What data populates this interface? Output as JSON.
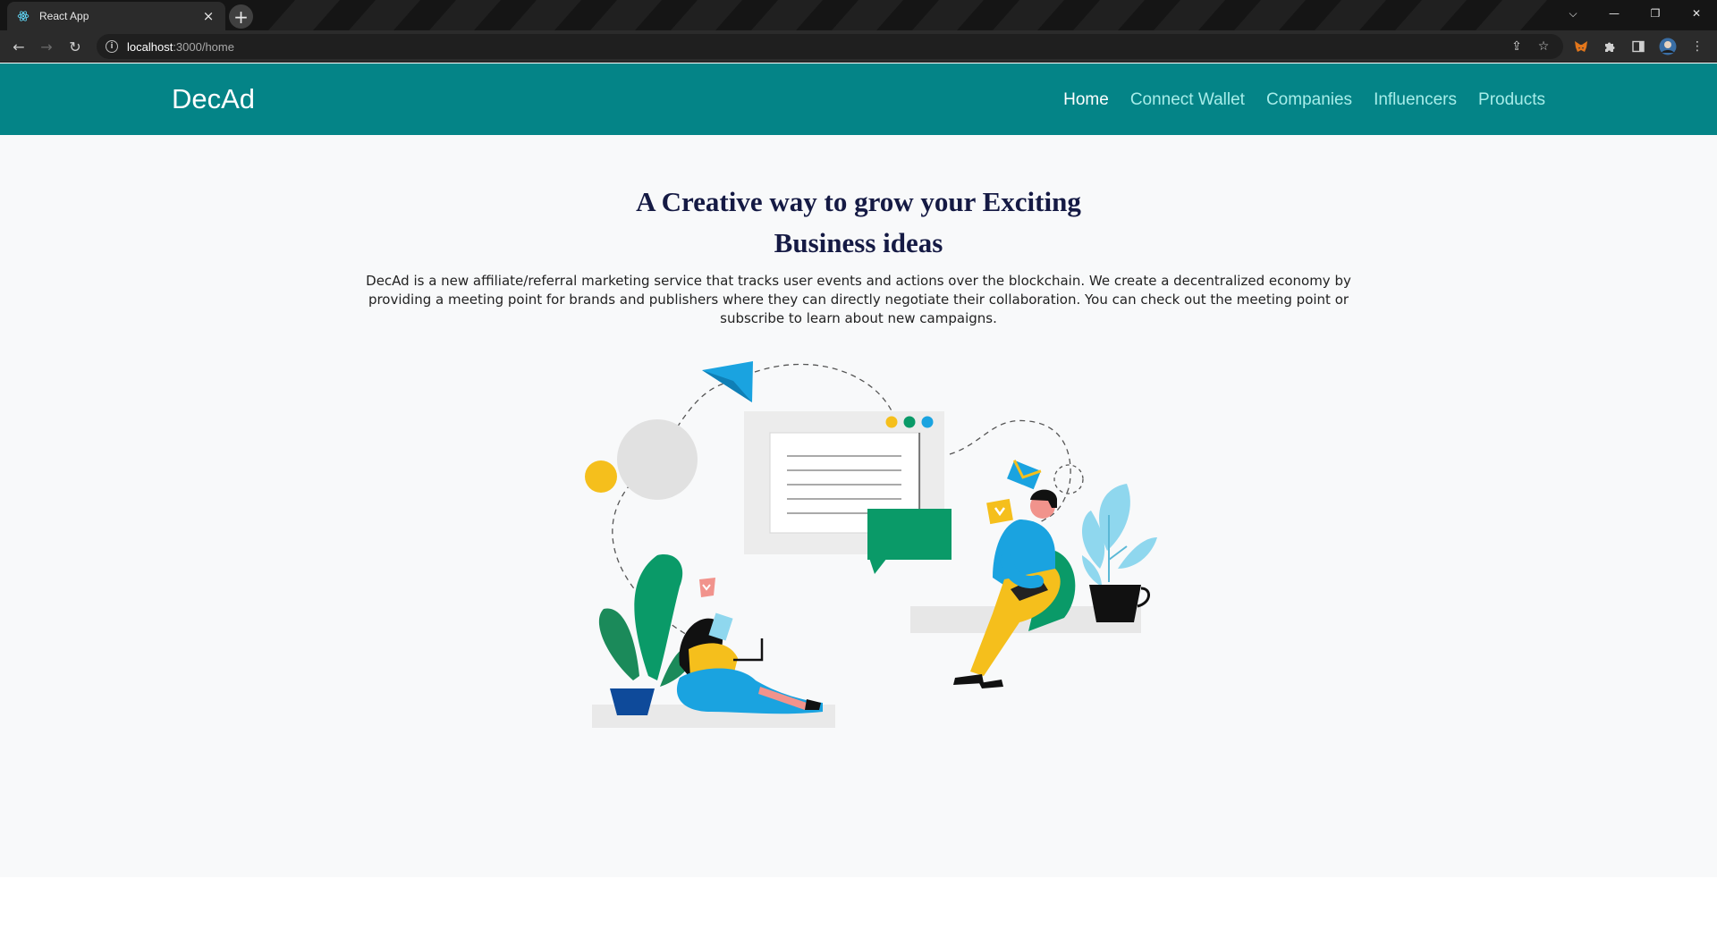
{
  "browser": {
    "tab_title": "React App",
    "tab_close": "×",
    "new_tab": "+",
    "url_host": "localhost",
    "url_path": ":3000/home",
    "window_controls": {
      "dropdown": "⌵",
      "minimize": "—",
      "restore": "❐",
      "close": "✕"
    }
  },
  "site": {
    "brand": "DecAd",
    "nav": [
      {
        "label": "Home"
      },
      {
        "label": "Connect Wallet"
      },
      {
        "label": "Companies"
      },
      {
        "label": "Influencers"
      },
      {
        "label": "Products"
      }
    ],
    "hero": {
      "title_line1": "A Creative way to grow your Exciting",
      "title_line2": "Business ideas",
      "description": "DecAd is a new affiliate/referral marketing service that tracks user events and actions over the blockchain. We create a decentralized economy by providing a meeting point for brands and publishers where they can directly negotiate their collaboration. You can check out the meeting point or subscribe to learn about new campaigns."
    }
  },
  "colors": {
    "navbar": "#048487",
    "nav_link": "#a7ede9",
    "title": "#151a44",
    "green": "#0a9a68",
    "blue": "#1aa3e0",
    "yellow": "#f5bf1c",
    "skin": "#f1938c"
  }
}
